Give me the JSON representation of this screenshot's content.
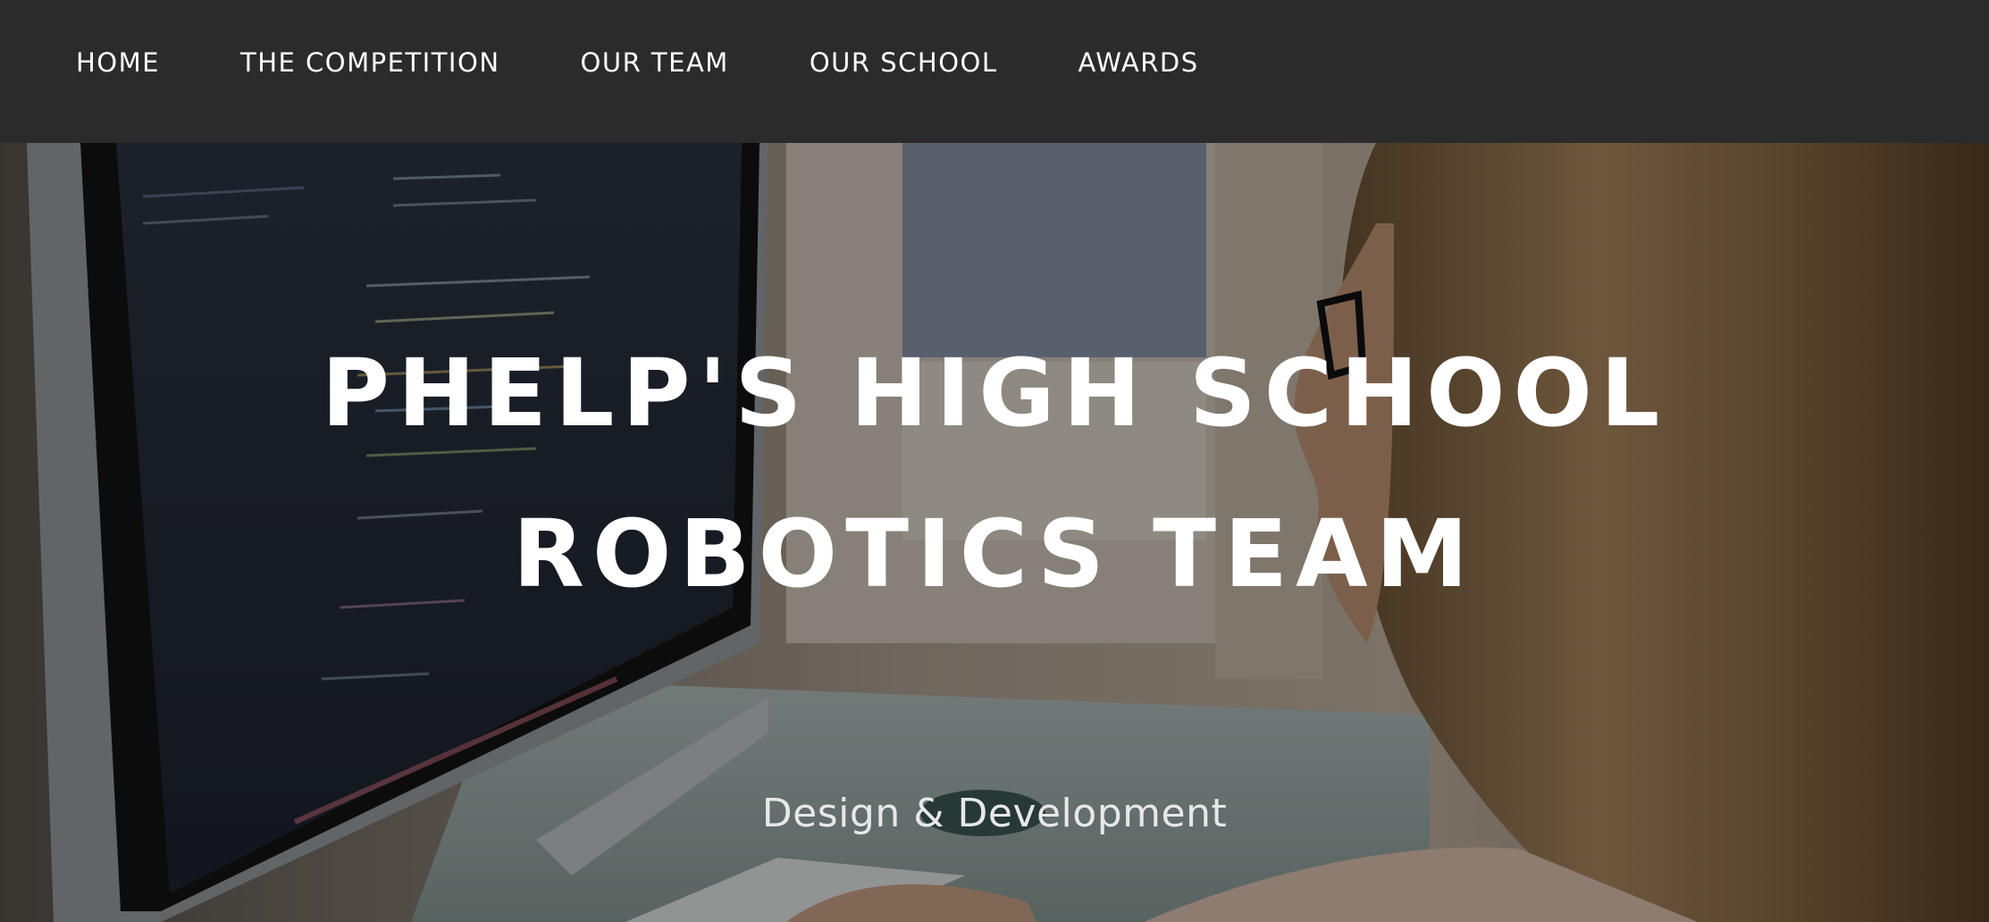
{
  "nav": {
    "items": [
      {
        "label": "HOME"
      },
      {
        "label": "THE COMPETITION"
      },
      {
        "label": "OUR TEAM"
      },
      {
        "label": "OUR SCHOOL"
      },
      {
        "label": "AWARDS"
      }
    ]
  },
  "hero": {
    "title_line1": "PHELP'S HIGH SCHOOL",
    "title_line2": "ROBOTICS TEAM",
    "subtitle": "Design & Development"
  },
  "colors": {
    "navbar_bg": "#2b2b2b",
    "nav_text": "#ffffff",
    "hero_title": "#ffffff",
    "hero_subtitle": "#e8e8e8"
  }
}
